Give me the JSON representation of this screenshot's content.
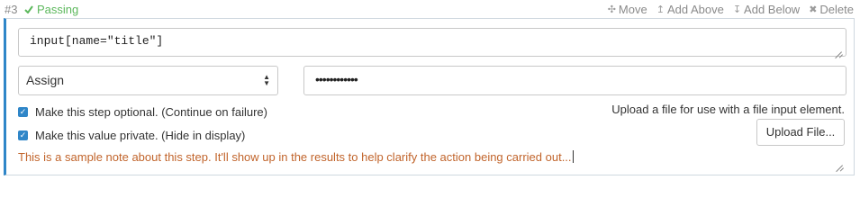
{
  "header": {
    "step_number": "#3",
    "status_icon": "check-icon",
    "status_label": "Passing",
    "status_color": "#5cb85c",
    "actions": [
      {
        "icon": "move-icon",
        "label": "Move"
      },
      {
        "icon": "arrow-up-icon",
        "label": "Add Above"
      },
      {
        "icon": "arrow-down-icon",
        "label": "Add Below"
      },
      {
        "icon": "close-icon",
        "label": "Delete"
      }
    ]
  },
  "step": {
    "accent_color": "#2f86c8",
    "selector_value": "input[name=\"title\"]",
    "action_select": {
      "selected": "Assign"
    },
    "value_masked": "••••••••••••",
    "options": [
      {
        "label": "Make this step optional. (Continue on failure)",
        "checked": true
      },
      {
        "label": "Make this value private. (Hide in display)",
        "checked": true
      }
    ],
    "upload_hint": "Upload a file for use with a file input element.",
    "upload_button": "Upload File...",
    "note": "This is a sample note about this step. It'll show up in the results to help clarify the action being carried out..."
  }
}
